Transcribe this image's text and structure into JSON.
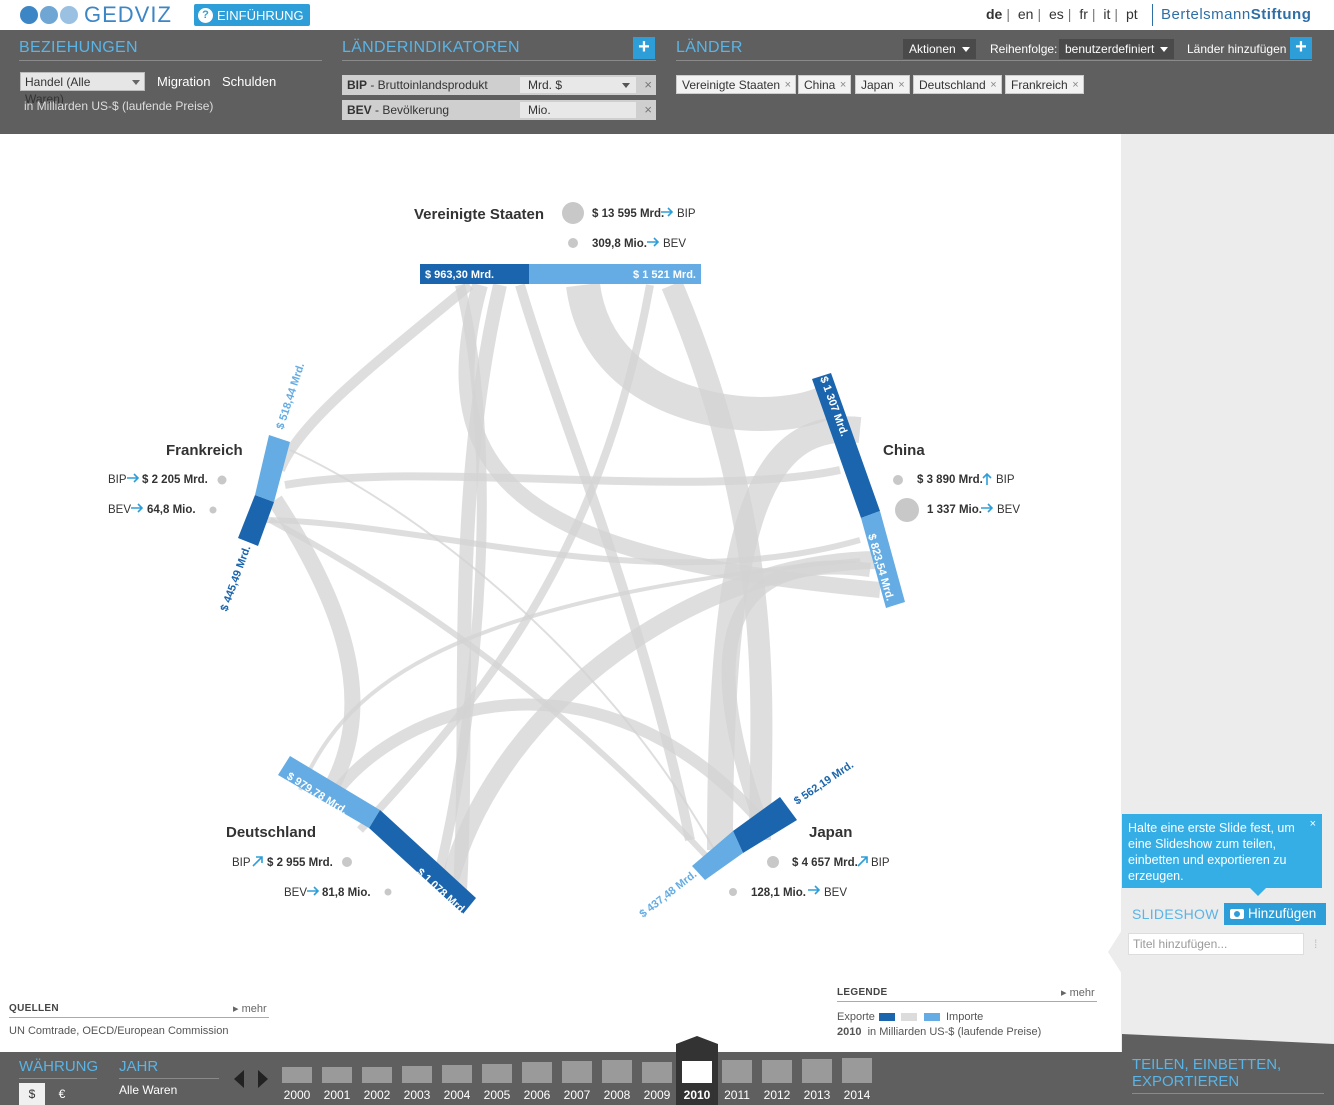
{
  "app": {
    "logo_text": "GEDVIZ",
    "intro_label": "EINFÜHRUNG",
    "languages": [
      "de",
      "en",
      "es",
      "fr",
      "it",
      "pt"
    ],
    "active_language": "de",
    "brand_light": "Bertelsmann",
    "brand_bold": "Stiftung"
  },
  "relations": {
    "title": "BEZIEHUNGEN",
    "selected": "Handel (Alle Waren)",
    "links": [
      "Migration",
      "Schulden"
    ],
    "unit_note": "in Milliarden US-$ (laufende Preise)"
  },
  "indicators": {
    "title": "LÄNDERINDIKATOREN",
    "rows": [
      {
        "code": "BIP",
        "name": " - Bruttoinlandsprodukt",
        "unit": "Mrd. $"
      },
      {
        "code": "BEV",
        "name": " - Bevölkerung",
        "unit": "Mio."
      }
    ]
  },
  "countries_panel": {
    "title": "LÄNDER",
    "actions_label": "Aktionen",
    "order_label": "Reihenfolge:",
    "order_value": "benutzerdefiniert",
    "add_label": "Länder hinzufügen",
    "chips": [
      "Vereinigte Staaten",
      "China",
      "Japan",
      "Deutschland",
      "Frankreich"
    ]
  },
  "countries": [
    {
      "name": "Vereinigte Staaten",
      "bip": "$ 13 595 Mrd.",
      "bev": "309,8 Mio.",
      "bip_label": "BIP",
      "bev_label": "BEV",
      "exports": "$ 963,30 Mrd.",
      "imports": "$ 1 521 Mrd."
    },
    {
      "name": "China",
      "bip": "$ 3 890 Mrd.",
      "bev": "1 337 Mio.",
      "bip_label": "BIP",
      "bev_label": "BEV",
      "exports": "$ 1 307 Mrd.",
      "imports": "$ 823,54 Mrd."
    },
    {
      "name": "Japan",
      "bip": "$ 4 657 Mrd.",
      "bev": "128,1 Mio.",
      "bip_label": "BIP",
      "bev_label": "BEV",
      "exports": "$ 562,19 Mrd.",
      "imports": "$ 437,48 Mrd."
    },
    {
      "name": "Deutschland",
      "bip": "$ 2 955 Mrd.",
      "bev": "81,8 Mio.",
      "bip_label": "BIP",
      "bev_label": "BEV",
      "exports": "$ 1 078 Mrd.",
      "imports": "$ 979,78 Mrd."
    },
    {
      "name": "Frankreich",
      "bip": "$ 2 205 Mrd.",
      "bev": "64,8 Mio.",
      "bip_label": "BIP",
      "bev_label": "BEV",
      "exports": "$ 445,49 Mrd.",
      "imports": "$ 518,44 Mrd."
    }
  ],
  "sources": {
    "title": "QUELLEN",
    "more": "mehr",
    "text": "UN Comtrade, OECD/European Commission"
  },
  "legend": {
    "title": "LEGENDE",
    "more": "mehr",
    "exports_label": "Exporte",
    "imports_label": "Importe",
    "year": "2010",
    "note": "in Milliarden US-$ (laufende Preise)"
  },
  "slideshow": {
    "tooltip": "Halte eine erste Slide fest, um eine Slideshow zum teilen, einbetten und exportieren zu erzeugen.",
    "title": "SLIDESHOW",
    "add_label": "Hinzufügen",
    "title_placeholder": "Titel hinzufügen..."
  },
  "share": {
    "title_line1": "TEILEN, EINBETTEN,",
    "title_line2": "EXPORTIEREN"
  },
  "bottom": {
    "currency_title": "WÄHRUNG",
    "currencies": [
      "$",
      "€"
    ],
    "active_currency": "$",
    "year_title": "JAHR",
    "year_sub": "Alle Waren",
    "years": [
      "2000",
      "2001",
      "2002",
      "2003",
      "2004",
      "2005",
      "2006",
      "2007",
      "2008",
      "2009",
      "2010",
      "2011",
      "2012",
      "2013",
      "2014"
    ],
    "active_year": "2010"
  },
  "colors": {
    "exports": "#1a65ad",
    "imports": "#64ace3",
    "accent": "#2e9ed8",
    "panel": "#5f5f5f",
    "flows": "#d8d8d8"
  }
}
